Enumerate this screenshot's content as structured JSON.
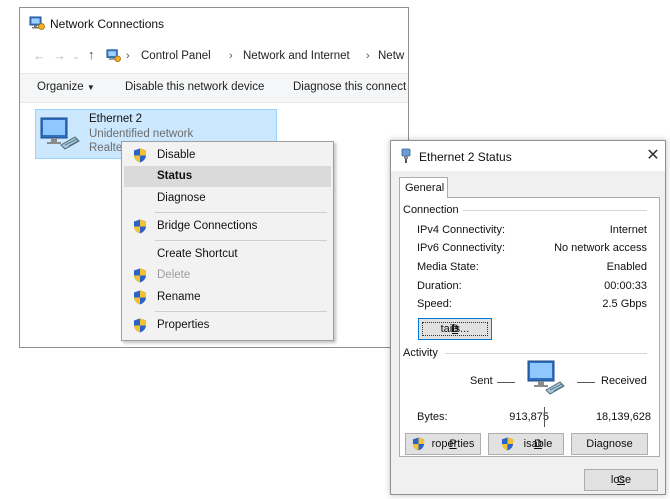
{
  "explorer": {
    "title": "Network Connections",
    "breadcrumb": [
      "Control Panel",
      "Network and Internet",
      "Netw"
    ],
    "toolbar": {
      "organize": "Organize",
      "disable_device": "Disable this network device",
      "diagnose": "Diagnose this connect"
    },
    "connection": {
      "name": "Ethernet 2",
      "status": "Unidentified network",
      "adapter": "Realtel"
    }
  },
  "context_menu": {
    "items": [
      {
        "label": "Disable",
        "icon": "shield-icon"
      },
      {
        "label": "Status",
        "icon": ""
      },
      {
        "label": "Diagnose",
        "icon": ""
      },
      {
        "label": "Bridge Connections",
        "icon": "shield-icon"
      },
      {
        "label": "Create Shortcut",
        "icon": ""
      },
      {
        "label": "Delete",
        "icon": "shield-icon"
      },
      {
        "label": "Rename",
        "icon": "shield-icon"
      },
      {
        "label": "Properties",
        "icon": "shield-icon"
      }
    ]
  },
  "dialog": {
    "title": "Ethernet 2 Status",
    "close_glyph": "✕",
    "tab": "General",
    "connection_group": "Connection",
    "rows": [
      {
        "label": "IPv4 Connectivity:",
        "value": "Internet"
      },
      {
        "label": "IPv6 Connectivity:",
        "value": "No network access"
      },
      {
        "label": "Media State:",
        "value": "Enabled"
      },
      {
        "label": "Duration:",
        "value": "00:00:33"
      },
      {
        "label": "Speed:",
        "value": "2.5 Gbps"
      }
    ],
    "details_button": {
      "pre": "D",
      "ul": "e",
      "post": "tails..."
    },
    "activity_group": "Activity",
    "sent_label": "Sent",
    "received_label": "Received",
    "bytes_label": "Bytes:",
    "bytes_sent": "913,875",
    "bytes_received": "18,139,628",
    "properties_button": {
      "ul": "P",
      "post": "roperties"
    },
    "disable_button": {
      "ul": "D",
      "post": "isable"
    },
    "diagnose_button": "Diagnose",
    "close_button": {
      "ul": "C",
      "post": "lose"
    }
  },
  "colors": {
    "selection_bg": "#cce8ff",
    "selection_border": "#99d1ff",
    "menu_highlight": "#dadada",
    "focus_blue": "#0078d7"
  }
}
